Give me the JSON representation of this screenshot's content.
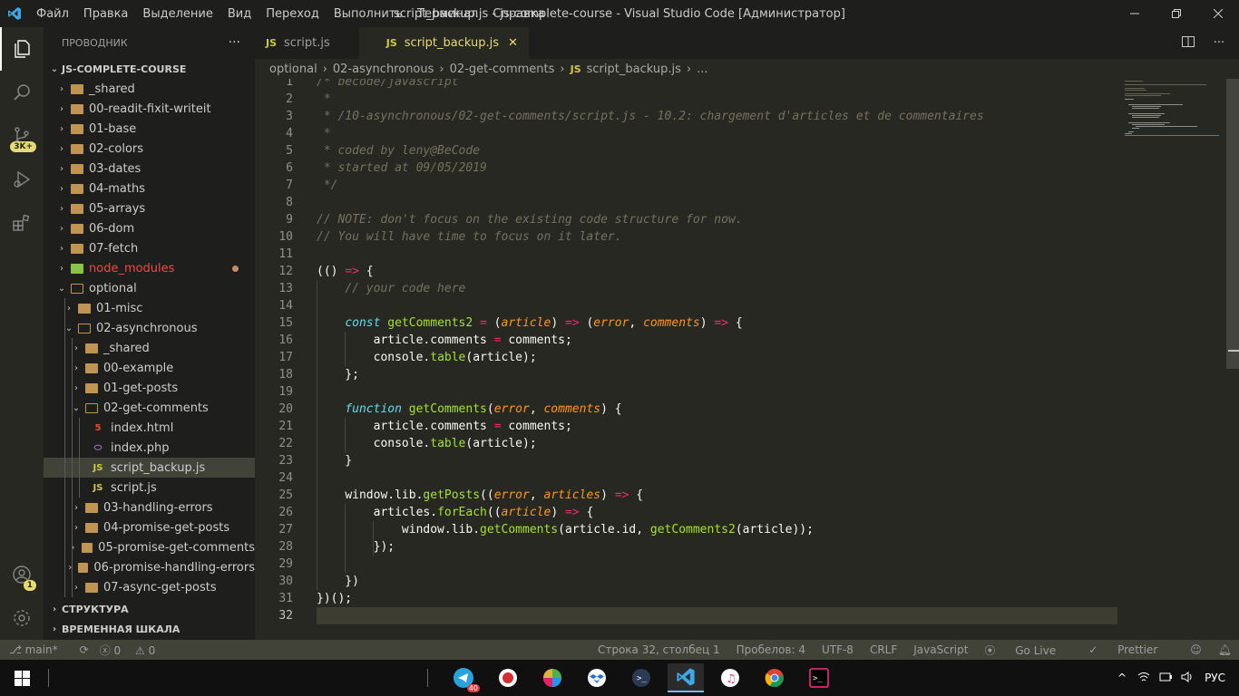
{
  "titlebar": {
    "menu": [
      "Файл",
      "Правка",
      "Выделение",
      "Вид",
      "Переход",
      "Выполнить",
      "Терминал",
      "Справка"
    ],
    "title": "script_backup.js - js-complete-course - Visual Studio Code [Администратор]"
  },
  "activity": {
    "source_control_badge": "3K+",
    "accounts_badge": "1"
  },
  "sidebar": {
    "header": "ПРОВОДНИК",
    "root": "JS-COMPLETE-COURSE",
    "tree": [
      {
        "label": "_shared",
        "depth": 1,
        "kind": "folder",
        "open": false
      },
      {
        "label": "00-readit-fixit-writeit",
        "depth": 1,
        "kind": "folder",
        "open": false
      },
      {
        "label": "01-base",
        "depth": 1,
        "kind": "folder",
        "open": false
      },
      {
        "label": "02-colors",
        "depth": 1,
        "kind": "folder",
        "open": false
      },
      {
        "label": "03-dates",
        "depth": 1,
        "kind": "folder",
        "open": false
      },
      {
        "label": "04-maths",
        "depth": 1,
        "kind": "folder",
        "open": false
      },
      {
        "label": "05-arrays",
        "depth": 1,
        "kind": "folder",
        "open": false
      },
      {
        "label": "06-dom",
        "depth": 1,
        "kind": "folder",
        "open": false
      },
      {
        "label": "07-fetch",
        "depth": 1,
        "kind": "folder",
        "open": false
      },
      {
        "label": "node_modules",
        "depth": 1,
        "kind": "folder",
        "open": false,
        "modified": true
      },
      {
        "label": "optional",
        "depth": 1,
        "kind": "folder",
        "open": true
      },
      {
        "label": "01-misc",
        "depth": 2,
        "kind": "folder",
        "open": false
      },
      {
        "label": "02-asynchronous",
        "depth": 2,
        "kind": "folder",
        "open": true
      },
      {
        "label": "_shared",
        "depth": 3,
        "kind": "folder",
        "open": false
      },
      {
        "label": "00-example",
        "depth": 3,
        "kind": "folder",
        "open": false
      },
      {
        "label": "01-get-posts",
        "depth": 3,
        "kind": "folder",
        "open": false
      },
      {
        "label": "02-get-comments",
        "depth": 3,
        "kind": "folder",
        "open": true
      },
      {
        "label": "index.html",
        "depth": 4,
        "kind": "html"
      },
      {
        "label": "index.php",
        "depth": 4,
        "kind": "php"
      },
      {
        "label": "script_backup.js",
        "depth": 4,
        "kind": "js",
        "selected": true
      },
      {
        "label": "script.js",
        "depth": 4,
        "kind": "js"
      },
      {
        "label": "03-handling-errors",
        "depth": 3,
        "kind": "folder",
        "open": false
      },
      {
        "label": "04-promise-get-posts",
        "depth": 3,
        "kind": "folder",
        "open": false
      },
      {
        "label": "05-promise-get-comments",
        "depth": 3,
        "kind": "folder",
        "open": false
      },
      {
        "label": "06-promise-handling-errors",
        "depth": 3,
        "kind": "folder",
        "open": false
      },
      {
        "label": "07-async-get-posts",
        "depth": 3,
        "kind": "folder",
        "open": false
      }
    ],
    "sections": [
      "СТРУКТУРА",
      "ВРЕМЕННАЯ ШКАЛА"
    ]
  },
  "tabs": [
    {
      "label": "script.js",
      "icon": "JS",
      "active": false
    },
    {
      "label": "script_backup.js",
      "icon": "JS",
      "active": true
    }
  ],
  "breadcrumb": [
    "optional",
    "02-asynchronous",
    "02-get-comments",
    "script_backup.js",
    "..."
  ],
  "breadcrumb_file_icon": "JS",
  "code": {
    "current_line": 32,
    "lines": [
      [
        [
          "c-com",
          "/* becode/javascript"
        ]
      ],
      [
        [
          "c-com",
          " *"
        ]
      ],
      [
        [
          "c-com",
          " * /10-asynchronous/02-get-comments/script.js - 10.2: chargement d'articles et de commentaires"
        ]
      ],
      [
        [
          "c-com",
          " *"
        ]
      ],
      [
        [
          "c-com",
          " * coded by leny@BeCode"
        ]
      ],
      [
        [
          "c-com",
          " * started at 09/05/2019"
        ]
      ],
      [
        [
          "c-com",
          " */"
        ]
      ],
      [],
      [
        [
          "c-com",
          "// NOTE: don't focus on the existing code structure for now."
        ]
      ],
      [
        [
          "c-com",
          "// You will have time to focus on it later."
        ]
      ],
      [],
      [
        [
          "c-pun",
          "(() "
        ],
        [
          "c-op",
          "=>"
        ],
        [
          "c-pun",
          " {"
        ]
      ],
      [
        [
          "c-pun",
          "    "
        ],
        [
          "c-com",
          "// your code here"
        ]
      ],
      [],
      [
        [
          "c-pun",
          "    "
        ],
        [
          "c-kw",
          "const"
        ],
        [
          "c-pun",
          " "
        ],
        [
          "c-fn",
          "getComments2"
        ],
        [
          "c-pun",
          " "
        ],
        [
          "c-op",
          "="
        ],
        [
          "c-pun",
          " ("
        ],
        [
          "c-par",
          "article"
        ],
        [
          "c-pun",
          ") "
        ],
        [
          "c-op",
          "=>"
        ],
        [
          "c-pun",
          " ("
        ],
        [
          "c-par",
          "error"
        ],
        [
          "c-pun",
          ", "
        ],
        [
          "c-par",
          "comments"
        ],
        [
          "c-pun",
          ") "
        ],
        [
          "c-op",
          "=>"
        ],
        [
          "c-pun",
          " {"
        ]
      ],
      [
        [
          "c-pun",
          "        "
        ],
        [
          "c-id",
          "article"
        ],
        [
          "c-pun",
          "."
        ],
        [
          "c-id",
          "comments"
        ],
        [
          "c-pun",
          " "
        ],
        [
          "c-op",
          "="
        ],
        [
          "c-pun",
          " "
        ],
        [
          "c-id",
          "comments"
        ],
        [
          "c-pun",
          ";"
        ]
      ],
      [
        [
          "c-pun",
          "        "
        ],
        [
          "c-id",
          "console"
        ],
        [
          "c-pun",
          "."
        ],
        [
          "c-fn",
          "table"
        ],
        [
          "c-pun",
          "("
        ],
        [
          "c-id",
          "article"
        ],
        [
          "c-pun",
          ");"
        ]
      ],
      [
        [
          "c-pun",
          "    };"
        ]
      ],
      [],
      [
        [
          "c-pun",
          "    "
        ],
        [
          "c-kw",
          "function"
        ],
        [
          "c-pun",
          " "
        ],
        [
          "c-fn",
          "getComments"
        ],
        [
          "c-pun",
          "("
        ],
        [
          "c-par",
          "error"
        ],
        [
          "c-pun",
          ", "
        ],
        [
          "c-par",
          "comments"
        ],
        [
          "c-pun",
          ") {"
        ]
      ],
      [
        [
          "c-pun",
          "        "
        ],
        [
          "c-id",
          "article"
        ],
        [
          "c-pun",
          "."
        ],
        [
          "c-id",
          "comments"
        ],
        [
          "c-pun",
          " "
        ],
        [
          "c-op",
          "="
        ],
        [
          "c-pun",
          " "
        ],
        [
          "c-id",
          "comments"
        ],
        [
          "c-pun",
          ";"
        ]
      ],
      [
        [
          "c-pun",
          "        "
        ],
        [
          "c-id",
          "console"
        ],
        [
          "c-pun",
          "."
        ],
        [
          "c-fn",
          "table"
        ],
        [
          "c-pun",
          "("
        ],
        [
          "c-id",
          "article"
        ],
        [
          "c-pun",
          ");"
        ]
      ],
      [
        [
          "c-pun",
          "    }"
        ]
      ],
      [],
      [
        [
          "c-pun",
          "    "
        ],
        [
          "c-id",
          "window"
        ],
        [
          "c-pun",
          "."
        ],
        [
          "c-id",
          "lib"
        ],
        [
          "c-pun",
          "."
        ],
        [
          "c-fn",
          "getPosts"
        ],
        [
          "c-pun",
          "(("
        ],
        [
          "c-par",
          "error"
        ],
        [
          "c-pun",
          ", "
        ],
        [
          "c-par",
          "articles"
        ],
        [
          "c-pun",
          ") "
        ],
        [
          "c-op",
          "=>"
        ],
        [
          "c-pun",
          " {"
        ]
      ],
      [
        [
          "c-pun",
          "        "
        ],
        [
          "c-id",
          "articles"
        ],
        [
          "c-pun",
          "."
        ],
        [
          "c-fn",
          "forEach"
        ],
        [
          "c-pun",
          "(("
        ],
        [
          "c-par",
          "article"
        ],
        [
          "c-pun",
          ") "
        ],
        [
          "c-op",
          "=>"
        ],
        [
          "c-pun",
          " {"
        ]
      ],
      [
        [
          "c-pun",
          "            "
        ],
        [
          "c-id",
          "window"
        ],
        [
          "c-pun",
          "."
        ],
        [
          "c-id",
          "lib"
        ],
        [
          "c-pun",
          "."
        ],
        [
          "c-fn",
          "getComments"
        ],
        [
          "c-pun",
          "("
        ],
        [
          "c-id",
          "article"
        ],
        [
          "c-pun",
          "."
        ],
        [
          "c-id",
          "id"
        ],
        [
          "c-pun",
          ", "
        ],
        [
          "c-fn",
          "getComments2"
        ],
        [
          "c-pun",
          "("
        ],
        [
          "c-id",
          "article"
        ],
        [
          "c-pun",
          "));"
        ]
      ],
      [
        [
          "c-pun",
          "        });"
        ]
      ],
      [],
      [
        [
          "c-pun",
          "    })"
        ]
      ],
      [
        [
          "c-pun",
          "})();"
        ]
      ],
      []
    ]
  },
  "statusbar": {
    "branch": "main*",
    "errors": "0",
    "warnings": "0",
    "position": "Строка 32, столбец 1",
    "spaces": "Пробелов: 4",
    "encoding": "UTF-8",
    "eol": "CRLF",
    "language": "JavaScript",
    "golive": "Go Live",
    "prettier": "Prettier"
  },
  "taskbar": {
    "telegram_badge": "40",
    "language": "РУС"
  }
}
